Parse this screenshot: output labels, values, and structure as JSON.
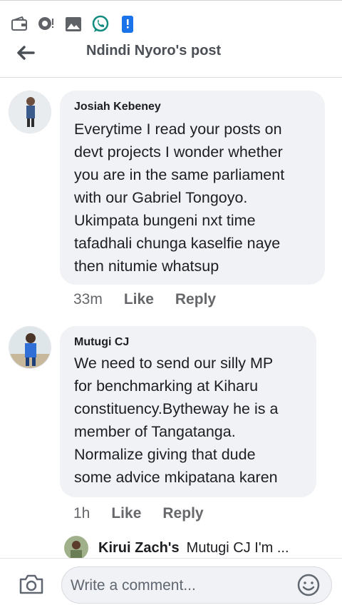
{
  "header": {
    "title": "Ndindi Nyoro's post"
  },
  "statusbar": {
    "icons": [
      "wallet-icon",
      "chat-bubble-icon",
      "gallery-icon",
      "whatsapp-icon",
      "phone-alert-icon"
    ]
  },
  "comments": [
    {
      "author": "Josiah Kebeney",
      "text": "Everytime I read your posts on\ndevt projects I wonder whether\nyou are in the same parliament\nwith our Gabriel Tongoyo.\nUkimpata bungeni nxt time\ntafadhali chunga kaselfie  naye\nthen nitumie whatsup",
      "time": "33m",
      "like_label": "Like",
      "reply_label": "Reply"
    },
    {
      "author": "Mutugi CJ",
      "text": "We need to send our silly MP\nfor benchmarking at Kiharu\nconstituency.Bytheway he is a\nmember of Tangatanga.\nNormalize giving that dude\nsome advice mkipatana karen",
      "time": "1h",
      "like_label": "Like",
      "reply_label": "Reply"
    }
  ],
  "reply_preview": {
    "name": "Kirui Zach's",
    "snippet": "Mutugi CJ I'm ..."
  },
  "composer": {
    "placeholder": "Write a comment..."
  },
  "colors": {
    "bubble": "#f0f2f5",
    "whatsapp": "#25D366",
    "accent": "#1877f2"
  }
}
